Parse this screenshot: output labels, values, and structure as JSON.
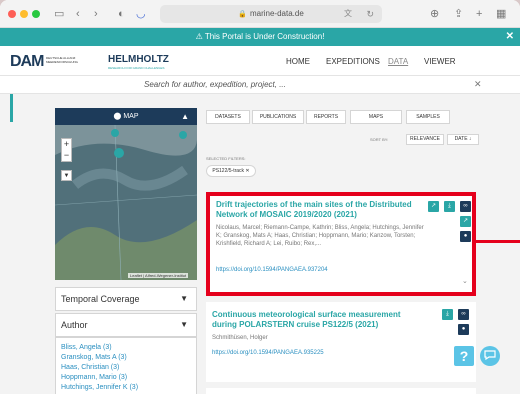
{
  "browser": {
    "url": "marine-data.de",
    "mid_icon": "translate-icon"
  },
  "banner": {
    "text": "This Portal is Under Construction!",
    "warning_icon": "⚠",
    "close": "✕"
  },
  "header": {
    "logo_dam": "DAM",
    "logo_dam_sub": "DEUTSCHE ALLIANZ MEERESFORSCHUNG",
    "logo_helmholtz": "HELMHOLTZ",
    "logo_helmholtz_sub": "RESEARCH FOR GRAND CHALLENGES",
    "nav": [
      "HOME",
      "EXPEDITIONS",
      "DATA",
      "VIEWER"
    ],
    "active_nav": "DATA"
  },
  "search": {
    "placeholder": "Search for author, expedition, project, ...",
    "clear": "✕"
  },
  "map_panel": {
    "label": "MAP",
    "leaflet_credit": "Leaflet | Alfred-Wegener-Institut"
  },
  "filters": {
    "temporal": "Temporal Coverage",
    "author": "Author",
    "authors": [
      "Bliss, Angela (3)",
      "Granskog, Mats A (3)",
      "Haas, Christian (3)",
      "Hoppmann, Mario (3)",
      "Hutchings, Jennifer K (3)"
    ]
  },
  "tabs": [
    "DATASETS",
    "PUBLICATIONS",
    "REPORTS",
    "MAPS",
    "SAMPLES"
  ],
  "sort": {
    "label": "SORT BY:",
    "relevance": "RELEVANCE",
    "date": "DATE ↓"
  },
  "selected_filters": {
    "label": "SELECTED FILTERS:",
    "chip": "PS122/5-track ✕"
  },
  "results": [
    {
      "title": "Drift trajectories of the main sites of the Distributed Network of MOSAIC 2019/2020 (2021)",
      "authors": "Nicolaus, Marcel; Riemann-Campe, Kathrin; Bliss, Angela; Hutchings, Jennifer K; Granskog, Mats A; Haas, Christian; Hoppmann, Mario; Kanzow, Torsten; Krishfield, Richard A; Lei, Ruibo; Rex,...",
      "doi": "https://doi.org/10.1594/PANGAEA.937204"
    },
    {
      "title": "Continuous meteorological surface measurement during POLARSTERN cruise PS122/5 (2021)",
      "authors": "Schmithüsen, Holger",
      "doi": "https://doi.org/10.1594/PANGAEA.935225"
    }
  ],
  "help": "?"
}
